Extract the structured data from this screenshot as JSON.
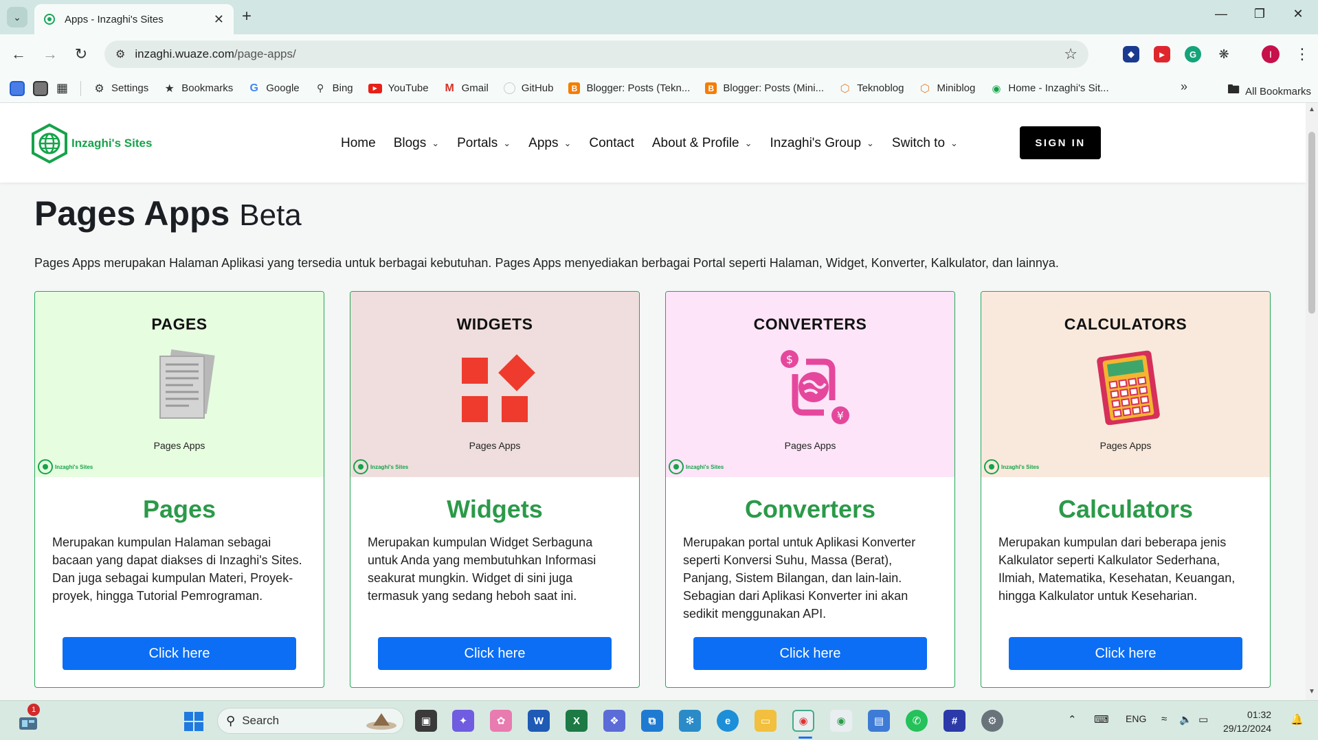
{
  "browser": {
    "tab_title": "Apps - Inzaghi's Sites",
    "url_host": "inzaghi.wuaze.com",
    "url_path": "/page-apps/",
    "profile_initial": "I"
  },
  "bookmarks": [
    {
      "label": "Settings",
      "icon": "gear-icon"
    },
    {
      "label": "Bookmarks",
      "icon": "star-icon"
    },
    {
      "label": "Google",
      "icon": "google-icon"
    },
    {
      "label": "Bing",
      "icon": "search-icon"
    },
    {
      "label": "YouTube",
      "icon": "youtube-icon"
    },
    {
      "label": "Gmail",
      "icon": "gmail-icon"
    },
    {
      "label": "GitHub",
      "icon": "github-icon"
    },
    {
      "label": "Blogger: Posts (Tekn...",
      "icon": "blogger-icon"
    },
    {
      "label": "Blogger: Posts (Mini...",
      "icon": "blogger-icon"
    },
    {
      "label": "Teknoblog",
      "icon": "hexagon-icon"
    },
    {
      "label": "Miniblog",
      "icon": "hexagon-icon"
    },
    {
      "label": "Home - Inzaghi's Sit...",
      "icon": "site-icon"
    }
  ],
  "bookmarks_all": "All Bookmarks",
  "site": {
    "logo_text": "Inzaghi's Sites",
    "nav": [
      {
        "label": "Home",
        "dropdown": false
      },
      {
        "label": "Blogs",
        "dropdown": true
      },
      {
        "label": "Portals",
        "dropdown": true
      },
      {
        "label": "Apps",
        "dropdown": true
      },
      {
        "label": "Contact",
        "dropdown": false
      },
      {
        "label": "About & Profile",
        "dropdown": true
      },
      {
        "label": "Inzaghi's Group",
        "dropdown": true
      },
      {
        "label": "Switch to",
        "dropdown": true
      }
    ],
    "signin_label": "SIGN IN"
  },
  "main": {
    "title": "Pages Apps",
    "title_badge": "Beta",
    "intro": "Pages Apps merupakan Halaman Aplikasi yang tersedia untuk berbagai kebutuhan. Pages Apps menyediakan berbagai Portal seperti Halaman, Widget, Konverter, Kalkulator, dan lainnya.",
    "cards": [
      {
        "banner_heading": "PAGES",
        "banner_sub": "Pages Apps",
        "banner_logo": "Inzaghi's Sites",
        "banner_color": "#e6fde0",
        "icon": "documents-icon",
        "title": "Pages",
        "description": "Merupakan kumpulan Halaman sebagai bacaan yang dapat diakses di Inzaghi's Sites. Dan juga sebagai kumpulan Materi, Proyek-proyek, hingga Tutorial Pemrograman.",
        "button": "Click here"
      },
      {
        "banner_heading": "WIDGETS",
        "banner_sub": "Pages Apps",
        "banner_logo": "Inzaghi's Sites",
        "banner_color": "#efdedd",
        "icon": "widgets-icon",
        "title": "Widgets",
        "description": "Merupakan kumpulan Widget Serbaguna untuk Anda yang membutuhkan Informasi seakurat mungkin. Widget di sini juga termasuk yang sedang heboh saat ini.",
        "button": "Click here"
      },
      {
        "banner_heading": "CONVERTERS",
        "banner_sub": "Pages Apps",
        "banner_logo": "Inzaghi's Sites",
        "banner_color": "#fde4f8",
        "icon": "currency-exchange-icon",
        "title": "Converters",
        "description": "Merupakan portal untuk Aplikasi Konverter seperti Konversi Suhu, Massa (Berat), Panjang, Sistem Bilangan, dan lain-lain. Sebagian dari Aplikasi Konverter ini akan sedikit menggunakan API.",
        "button": "Click here"
      },
      {
        "banner_heading": "CALCULATORS",
        "banner_sub": "Pages Apps",
        "banner_logo": "Inzaghi's Sites",
        "banner_color": "#f9e9dc",
        "icon": "calculator-icon",
        "title": "Calculators",
        "description": "Merupakan kumpulan dari beberapa jenis Kalkulator seperti Kalkulator Sederhana, Ilmiah, Matematika, Kesehatan, Keuangan, hingga Kalkulator untuk Keseharian.",
        "button": "Click here"
      }
    ]
  },
  "taskbar": {
    "search_placeholder": "Search",
    "widget_badge": "1",
    "language": "ENG",
    "time": "01:32",
    "date": "29/12/2024"
  },
  "colors": {
    "brand_green": "#16a34a",
    "card_title_green": "#2b9a49",
    "button_blue": "#0b6ef5"
  }
}
